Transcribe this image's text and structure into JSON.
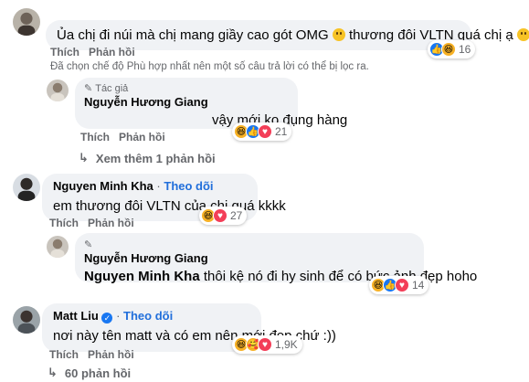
{
  "comments": [
    {
      "text": "Ủa chị đi núi mà chị mang giầy cao gót OMG",
      "text_tail": "thương đôi VLTN quá chị ạ",
      "like_label": "Thích",
      "reply_label": "Phản hồi",
      "reactions": [
        "like",
        "haha"
      ],
      "count": "16"
    },
    {
      "author_tag": "Tác giả",
      "name": "Nguyễn Hương Giang",
      "text": "vậy mới ko đụng hàng",
      "like_label": "Thích",
      "reply_label": "Phản hồi",
      "reactions": [
        "haha",
        "like",
        "love"
      ],
      "count": "21"
    },
    {
      "name": "Nguyen Minh Kha",
      "follow": "Theo dõi",
      "text": "em thương đôi VLTN của chị quá kkkk",
      "like_label": "Thích",
      "reply_label": "Phản hồi",
      "reactions": [
        "haha",
        "love"
      ],
      "count": "27"
    },
    {
      "name": "Nguyễn Hương Giang",
      "mention": "Nguyen Minh Kha",
      "text": "thôi kệ nó đi hy sinh để có bức ảnh đẹp hoho",
      "reactions": [
        "haha",
        "like",
        "love"
      ],
      "count": "14"
    },
    {
      "name": "Matt Liu",
      "follow": "Theo dõi",
      "text": "nơi này tên matt và có em nên mới đẹp chứ :))",
      "like_label": "Thích",
      "reply_label": "Phản hồi",
      "reactions": [
        "haha",
        "care",
        "love"
      ],
      "count": "1,9K"
    }
  ],
  "filter_note": "Đã chọn chế độ Phù hợp nhất nên một số câu trả lời có thể bị lọc ra.",
  "view_more_replies": "Xem thêm 1 phản hồi",
  "view_more_comments": "60 phản hồi",
  "colors": {
    "link": "#216fdb",
    "bubble": "#f0f2f5",
    "meta": "#65676b"
  }
}
